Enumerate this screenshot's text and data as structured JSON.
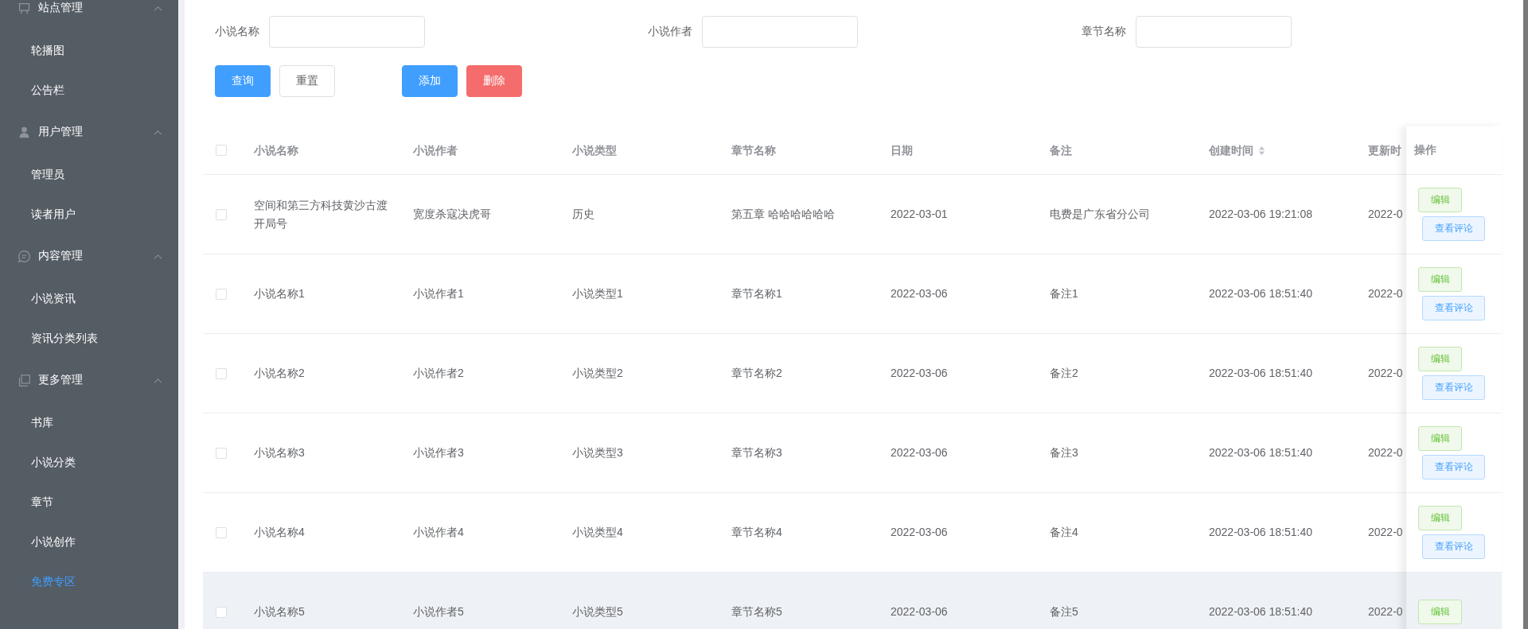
{
  "sidebar": {
    "groups": [
      {
        "title": "站点管理",
        "expanded": true,
        "items": [
          {
            "label": "轮播图",
            "selected": false
          },
          {
            "label": "公告栏",
            "selected": false
          }
        ]
      },
      {
        "title": "用户管理",
        "expanded": true,
        "items": [
          {
            "label": "管理员",
            "selected": false
          },
          {
            "label": "读者用户",
            "selected": false
          }
        ]
      },
      {
        "title": "内容管理",
        "expanded": true,
        "items": [
          {
            "label": "小说资讯",
            "selected": false
          },
          {
            "label": "资讯分类列表",
            "selected": false
          }
        ]
      },
      {
        "title": "更多管理",
        "expanded": true,
        "items": [
          {
            "label": "书库",
            "selected": false
          },
          {
            "label": "小说分类",
            "selected": false
          },
          {
            "label": "章节",
            "selected": false
          },
          {
            "label": "小说创作",
            "selected": false
          },
          {
            "label": "免费专区",
            "selected": true
          }
        ]
      }
    ]
  },
  "filters": [
    {
      "label": "小说名称"
    },
    {
      "label": "小说作者"
    },
    {
      "label": "章节名称"
    }
  ],
  "buttons": [
    {
      "label": "查询",
      "kind": "primary"
    },
    {
      "label": "重置",
      "kind": "default"
    },
    {
      "label": "添加",
      "kind": "primary"
    },
    {
      "label": "删除",
      "kind": "danger"
    }
  ],
  "table": {
    "columns": [
      {
        "label": "小说名称",
        "sortable": false
      },
      {
        "label": "小说作者",
        "sortable": false
      },
      {
        "label": "小说类型",
        "sortable": false
      },
      {
        "label": "章节名称",
        "sortable": false
      },
      {
        "label": "日期",
        "sortable": false
      },
      {
        "label": "备注",
        "sortable": false
      },
      {
        "label": "创建时间",
        "sortable": true
      },
      {
        "label": "更新时"
      }
    ],
    "actions_header": "操作",
    "all_checked": false,
    "rows": [
      {
        "checked": false,
        "highlighted": false,
        "cells": [
          "空间和第三方科技黄沙古渡开局号",
          "宽度杀寇决虎哥",
          "历史",
          "第五章 哈哈哈哈哈哈",
          "2022-03-01",
          "电费是广东省分公司",
          "2022-03-06 19:21:08",
          "2022-0"
        ],
        "actions": [
          {
            "label": "编辑",
            "kind": "success"
          },
          {
            "label": "查看评论",
            "kind": "primary"
          }
        ]
      },
      {
        "checked": false,
        "highlighted": false,
        "cells": [
          "小说名称1",
          "小说作者1",
          "小说类型1",
          "章节名称1",
          "2022-03-06",
          "备注1",
          "2022-03-06 18:51:40",
          "2022-0"
        ],
        "actions": [
          {
            "label": "编辑",
            "kind": "success"
          },
          {
            "label": "查看评论",
            "kind": "primary"
          }
        ]
      },
      {
        "checked": false,
        "highlighted": false,
        "cells": [
          "小说名称2",
          "小说作者2",
          "小说类型2",
          "章节名称2",
          "2022-03-06",
          "备注2",
          "2022-03-06 18:51:40",
          "2022-0"
        ],
        "actions": [
          {
            "label": "编辑",
            "kind": "success"
          },
          {
            "label": "查看评论",
            "kind": "primary"
          }
        ]
      },
      {
        "checked": false,
        "highlighted": false,
        "cells": [
          "小说名称3",
          "小说作者3",
          "小说类型3",
          "章节名称3",
          "2022-03-06",
          "备注3",
          "2022-03-06 18:51:40",
          "2022-0"
        ],
        "actions": [
          {
            "label": "编辑",
            "kind": "success"
          },
          {
            "label": "查看评论",
            "kind": "primary"
          }
        ]
      },
      {
        "checked": false,
        "highlighted": false,
        "cells": [
          "小说名称4",
          "小说作者4",
          "小说类型4",
          "章节名称4",
          "2022-03-06",
          "备注4",
          "2022-03-06 18:51:40",
          "2022-0"
        ],
        "actions": [
          {
            "label": "编辑",
            "kind": "success"
          },
          {
            "label": "查看评论",
            "kind": "primary"
          }
        ]
      },
      {
        "checked": false,
        "highlighted": true,
        "cells": [
          "小说名称5",
          "小说作者5",
          "小说类型5",
          "章节名称5",
          "2022-03-06",
          "备注5",
          "2022-03-06 18:51:40",
          "2022-0"
        ],
        "actions": [
          {
            "label": "编辑",
            "kind": "success"
          }
        ]
      }
    ]
  }
}
